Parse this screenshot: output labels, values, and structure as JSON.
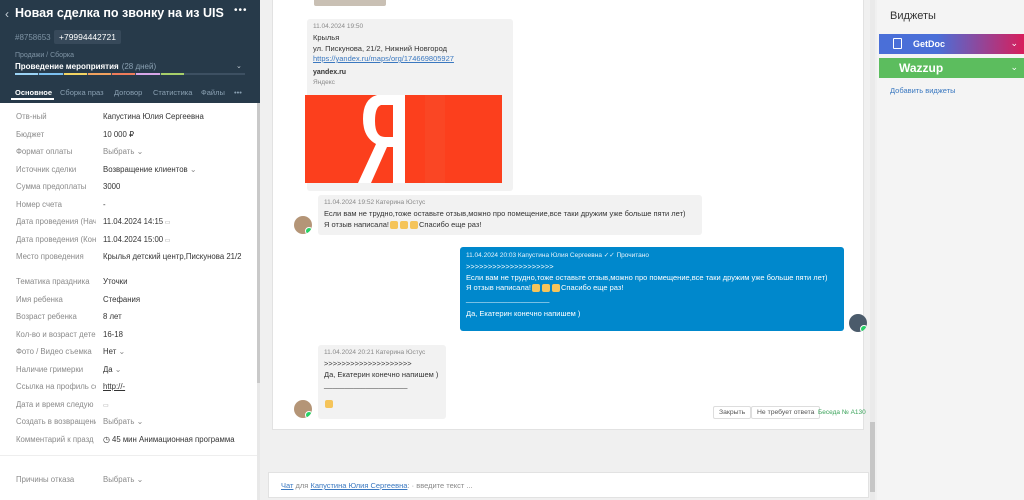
{
  "deal": {
    "title": "Новая сделка по звонку на из UIS",
    "id": "#8758653",
    "phone": "+79994442721",
    "pipeline": "Продажи / Сборка",
    "stage": "Проведение мероприятия",
    "stage_days": "(28 дней)",
    "tabs": [
      "Основное",
      "Сборка праз",
      "Договор",
      "Статистика",
      "Файлы"
    ],
    "stage_colors": [
      "#9bd3f5",
      "#7cc0f0",
      "#f3d463",
      "#f2a25f",
      "#ef7c5b",
      "#d8a6e8",
      "#a7cf6a"
    ]
  },
  "fields": [
    {
      "label": "Отв-ный",
      "value": "Капустина Юлия Сергеевна"
    },
    {
      "label": "Бюджет",
      "value": "10 000  ₽"
    },
    {
      "label": "Формат оплаты",
      "value": "Выбрать"
    },
    {
      "label": "Источник сделки",
      "value": "Возвращение клиентов"
    },
    {
      "label": "Сумма предоплаты",
      "value": "3000"
    },
    {
      "label": "Номер счета",
      "value": "-"
    },
    {
      "label": "Дата проведения (Нач",
      "value": "11.04.2024 14:15"
    },
    {
      "label": "Дата проведения (Кон",
      "value": "11.04.2024 15:00"
    },
    {
      "label": "Место проведения",
      "value": "Крылья детский центр,Пискунова 21/2"
    },
    {
      "label": "Тематика праздника",
      "value": "Уточки"
    },
    {
      "label": "Имя ребенка",
      "value": "Стефания"
    },
    {
      "label": "Возраст ребенка",
      "value": "8 лет"
    },
    {
      "label": "Кол-во и возраст дете",
      "value": "16-18"
    },
    {
      "label": "Фото / Видео съемка",
      "value": "Нет"
    },
    {
      "label": "Наличие гримерки",
      "value": "Да"
    },
    {
      "label": "Ссылка на профиль сс",
      "value": "http://-"
    },
    {
      "label": "Дата и время следую",
      "value": ""
    },
    {
      "label": "Создать в возвращени",
      "value": "Выбрать"
    },
    {
      "label": "Комментарий к празд",
      "value": "45 мин  Анимационная программа"
    },
    {
      "label": "Причины отказа",
      "value": "Выбрать"
    }
  ],
  "messages": {
    "m1": {
      "meta": "11.04.2024 19:50",
      "line1": "Крылья",
      "line2": "ул. Пискунова, 21/2, Нижний Новгород",
      "link": "https://yandex.ru/maps/org/174669805927",
      "site": "yandex.ru",
      "site_sub": "Яндекс",
      "logo_letter": "Я"
    },
    "m2": {
      "meta": "11.04.2024 19:52 Катерина Юстус",
      "line1": "Если вам не трудно,тоже оставьте отзыв,можно про помещение,все таки дружим уже больше пяти лет)",
      "line2": "Я отзыв написала!",
      "line2_tail": "Спасибо еще раз!"
    },
    "m3": {
      "meta": "11.04.2024 20:03 Капустина Юлия Сергеевна",
      "read": "✓✓ Прочитано",
      "quote": ">>>>>>>>>>>>>>>>>>>>",
      "line1": "Если вам не трудно,тоже оставьте отзыв,можно про помещение,все таки дружим уже больше пяти лет)",
      "line2": "Я отзыв написала!",
      "line2_tail": "Спасибо еще раз!",
      "divider": "____________________",
      "line3": "Да, Екатерин конечно напишем )"
    },
    "m4": {
      "meta": "11.04.2024 20:21 Катерина Юстус",
      "quote": ">>>>>>>>>>>>>>>>>>>>",
      "line1": "Да, Екатерин конечно напишем )",
      "divider": "____________________"
    }
  },
  "actions": {
    "close": "Закрыть",
    "no_reply": "Не требует ответа",
    "conversation": "Беседа № А130"
  },
  "chatbar": {
    "mode": "Чат",
    "for": "для",
    "user": "Капустина Юлия Сергеевна",
    "sep": ":",
    "placeholder": "введите текст ..."
  },
  "sidebar": {
    "title": "Виджеты",
    "widgets": [
      {
        "name": "GetDoc",
        "color": "#4a6fd8",
        "accent": "#d81e5b"
      },
      {
        "name": "Wazzup",
        "color": "#5cbd5e"
      }
    ],
    "add_label": "Добавить виджеты"
  }
}
